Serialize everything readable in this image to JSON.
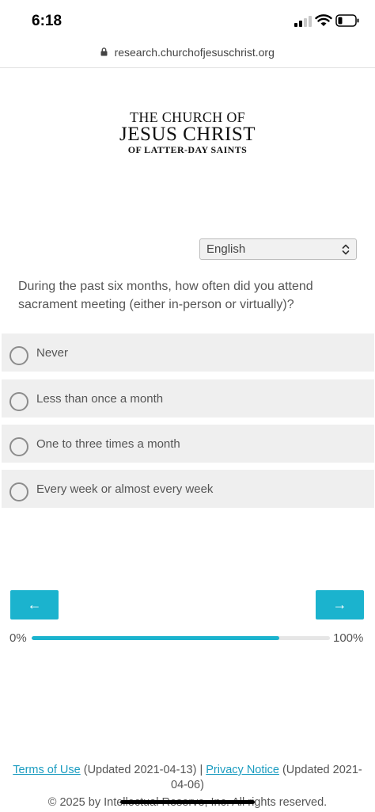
{
  "status_bar": {
    "time": "6:18"
  },
  "browser": {
    "url": "research.churchofjesuschrist.org"
  },
  "logo": {
    "line1": "THE CHURCH OF",
    "line2": "JESUS CHRIST",
    "line3": "OF LATTER-DAY SAINTS"
  },
  "language": {
    "selected": "English"
  },
  "question": "During the past six months, how often did you attend sacrament meeting (either in-person or virtually)?",
  "options": [
    {
      "label": "Never"
    },
    {
      "label": "Less than once a month"
    },
    {
      "label": "One to three times a month"
    },
    {
      "label": "Every week or almost every week"
    }
  ],
  "navigation": {
    "prev_label": "←",
    "next_label": "→"
  },
  "progress": {
    "start_label": "0%",
    "end_label": "100%",
    "fraction": 0.83
  },
  "footer": {
    "terms_label": "Terms of Use",
    "terms_updated": "(Updated 2021-04-13) |",
    "privacy_label": "Privacy Notice",
    "privacy_updated": "(Updated 2021-04-06)",
    "copyright": "© 2025 by Intellectual Reserve, Inc. All rights reserved."
  },
  "colors": {
    "accent": "#1bb3ce",
    "link": "#1b9cc0",
    "option_bg": "#efefef"
  }
}
